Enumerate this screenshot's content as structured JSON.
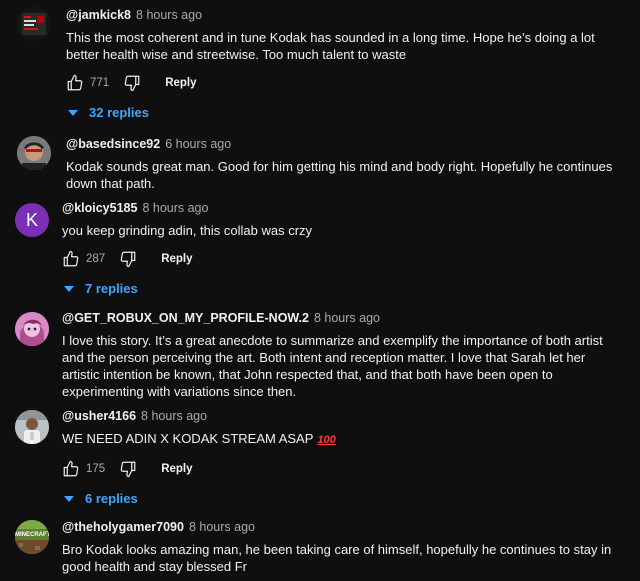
{
  "comments": [
    {
      "handle": "@jamkick8",
      "time": "8 hours ago",
      "text": "This the most coherent and in tune Kodak has sounded in a long time. Hope he’s doing a lot better health wise and streetwise. Too much talent to waste",
      "likes": "771",
      "reply_label": "Reply",
      "replies_label": "32 replies"
    },
    {
      "handle": "@basedsince92",
      "time": "6 hours ago",
      "text": "Kodak sounds great man. Good for him getting his mind and body right. Hopefully he continues down that path."
    },
    {
      "handle": "@kloicy5185",
      "time": "8 hours ago",
      "avatar_letter": "K",
      "avatar_color": "#7b2fb5",
      "text": "you keep grinding adin, this collab was crzy",
      "likes": "287",
      "reply_label": "Reply",
      "replies_label": "7 replies"
    },
    {
      "handle": "@GET_ROBUX_ON_MY_PROFILE-NOW.2",
      "time": "8 hours ago",
      "text": "I love this story. It’s a great anecdote to summarize and exemplify the importance of both artist and the person perceiving the art. Both intent and reception matter. I love that Sarah let her artistic intention be known, that John respected that, and that both have been open to experimenting with variations since then."
    },
    {
      "handle": "@usher4166",
      "time": "8 hours ago",
      "text": "WE NEED ADIN X KODAK STREAM ASAP",
      "emoji": "100",
      "likes": "175",
      "reply_label": "Reply",
      "replies_label": "6 replies"
    },
    {
      "handle": "@theholygamer7090",
      "time": "8 hours ago",
      "avatar_text": "MINECRAFT",
      "text": "Bro Kodak looks amazing man, he been taking care of himself, hopefully he continues to stay in good health and stay blessed Fr"
    }
  ],
  "colors": {
    "background": "#0f0f0f",
    "link_blue": "#3ea6ff",
    "muted": "#aaaaaa"
  }
}
